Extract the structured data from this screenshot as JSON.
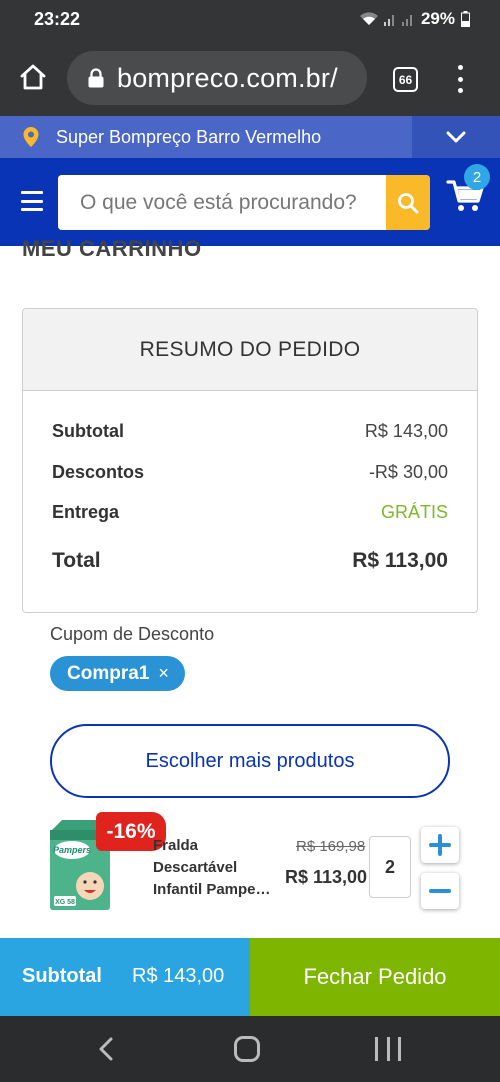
{
  "status_bar": {
    "time": "23:22",
    "battery": "29%",
    "icons": [
      "wifi-icon",
      "signal-icon",
      "signal-icon",
      "battery-icon"
    ]
  },
  "browser": {
    "url": "bompreco.com.br/",
    "tab_count": "66",
    "icons": [
      "home-icon",
      "lock-icon",
      "tabs-icon",
      "more-vert-icon"
    ]
  },
  "store_bar": {
    "store_name": "Super Bompreço Barro Vermelho",
    "icons": [
      "location-pin-icon",
      "chevron-down-icon"
    ]
  },
  "header": {
    "search_placeholder": "O que você está procurando?",
    "cart_count": "2",
    "icons": [
      "menu-icon",
      "search-icon",
      "cart-icon"
    ]
  },
  "page": {
    "title": "MEU CARRINHO"
  },
  "summary": {
    "heading": "RESUMO DO PEDIDO",
    "subtotal_label": "Subtotal",
    "subtotal_value": "R$ 143,00",
    "discount_label": "Descontos",
    "discount_value": "-R$ 30,00",
    "delivery_label": "Entrega",
    "delivery_value": "GRÁTIS",
    "total_label": "Total",
    "total_value": "R$ 113,00"
  },
  "coupon": {
    "label": "Cupom de Desconto",
    "code": "Compra1",
    "remove_symbol": "×"
  },
  "more_products_label": "Escolher mais produtos",
  "cart_items": [
    {
      "discount_badge": "-16%",
      "name_line1": "Fralda",
      "name_line2": "Descartável",
      "name_line3": "Infantil Pampe…",
      "old_price": "R$ 169,98",
      "price": "R$ 113,00",
      "quantity": "2",
      "package_brand": "Pampers",
      "package_size": "XG 58"
    }
  ],
  "bottom_bar": {
    "subtotal_label": "Subtotal",
    "subtotal_value": "R$ 143,00",
    "checkout_label": "Fechar Pedido"
  },
  "colors": {
    "header_blue": "#0a34b6",
    "store_bar": "#4a66c7",
    "search_button": "#f9b928",
    "checkout_green": "#7db500",
    "subtotal_blue": "#2ba4e2",
    "discount_red": "#e0231d",
    "free_green": "#7ab928"
  }
}
